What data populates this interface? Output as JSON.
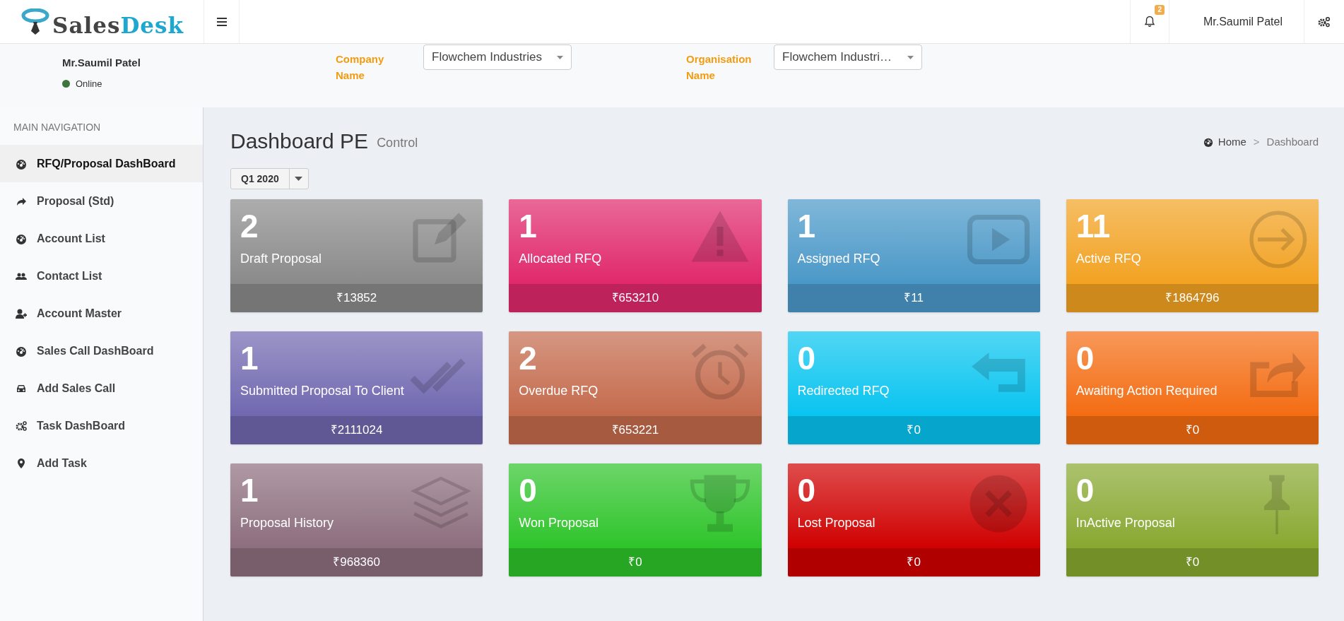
{
  "logo": {
    "part_1": "Sales",
    "part_2": "Desk"
  },
  "header": {
    "notifications": "2",
    "user_name": "Mr.Saumil Patel"
  },
  "user_panel": {
    "name": "Mr.Saumil Patel",
    "status": "Online",
    "online": true
  },
  "filters": [
    {
      "label": "Company Name",
      "value": "Flowchem Industries"
    },
    {
      "label": "Organisation Name",
      "value": "Flowchem Industri…"
    }
  ],
  "sidebar": {
    "heading": "MAIN NAVIGATION",
    "items": [
      {
        "label": "RFQ/Proposal DashBoard",
        "selected": true
      },
      {
        "label": "Proposal (Std)",
        "selected": false
      },
      {
        "label": "Account List",
        "selected": false
      },
      {
        "label": "Contact List",
        "selected": false
      },
      {
        "label": "Account Master",
        "selected": false
      },
      {
        "label": "Sales Call DashBoard",
        "selected": false
      },
      {
        "label": "Add Sales Call",
        "selected": false
      },
      {
        "label": "Task DashBoard",
        "selected": false
      },
      {
        "label": "Add Task",
        "selected": false
      }
    ]
  },
  "page": {
    "title": "Dashboard PE",
    "subtitle": "Control",
    "breadcrumb": [
      "Home",
      "Dashboard"
    ],
    "separator": ">",
    "period": "Q1 2020"
  },
  "cards": [
    {
      "count": "2",
      "label": "Draft Proposal",
      "amount": "₹13852",
      "color": "#8a8a8a"
    },
    {
      "count": "1",
      "label": "Allocated RFQ",
      "amount": "₹653210",
      "color": "#e0286b"
    },
    {
      "count": "1",
      "label": "Assigned RFQ",
      "amount": "₹11",
      "color": "#4a98c8"
    },
    {
      "count": "11",
      "label": "Active RFQ",
      "amount": "₹1864796",
      "color": "#f2a222"
    },
    {
      "count": "1",
      "label": "Submitted Proposal To Client",
      "amount": "₹2111024",
      "color": "#7068b0"
    },
    {
      "count": "2",
      "label": "Overdue RFQ",
      "amount": "₹653221",
      "color": "#c46a4c"
    },
    {
      "count": "0",
      "label": "Redirected RFQ",
      "amount": "₹0",
      "color": "#08c4f0"
    },
    {
      "count": "0",
      "label": "Awaiting Action Required",
      "amount": "₹0",
      "color": "#f46c12"
    },
    {
      "count": "1",
      "label": "Proposal History",
      "amount": "₹968360",
      "color": "#8d6e7e"
    },
    {
      "count": "0",
      "label": "Won Proposal",
      "amount": "₹0",
      "color": "#2ec42a"
    },
    {
      "count": "0",
      "label": "Lost Proposal",
      "amount": "₹0",
      "color": "#d00000"
    },
    {
      "count": "0",
      "label": "InActive Proposal",
      "amount": "₹0",
      "color": "#88a830"
    }
  ]
}
